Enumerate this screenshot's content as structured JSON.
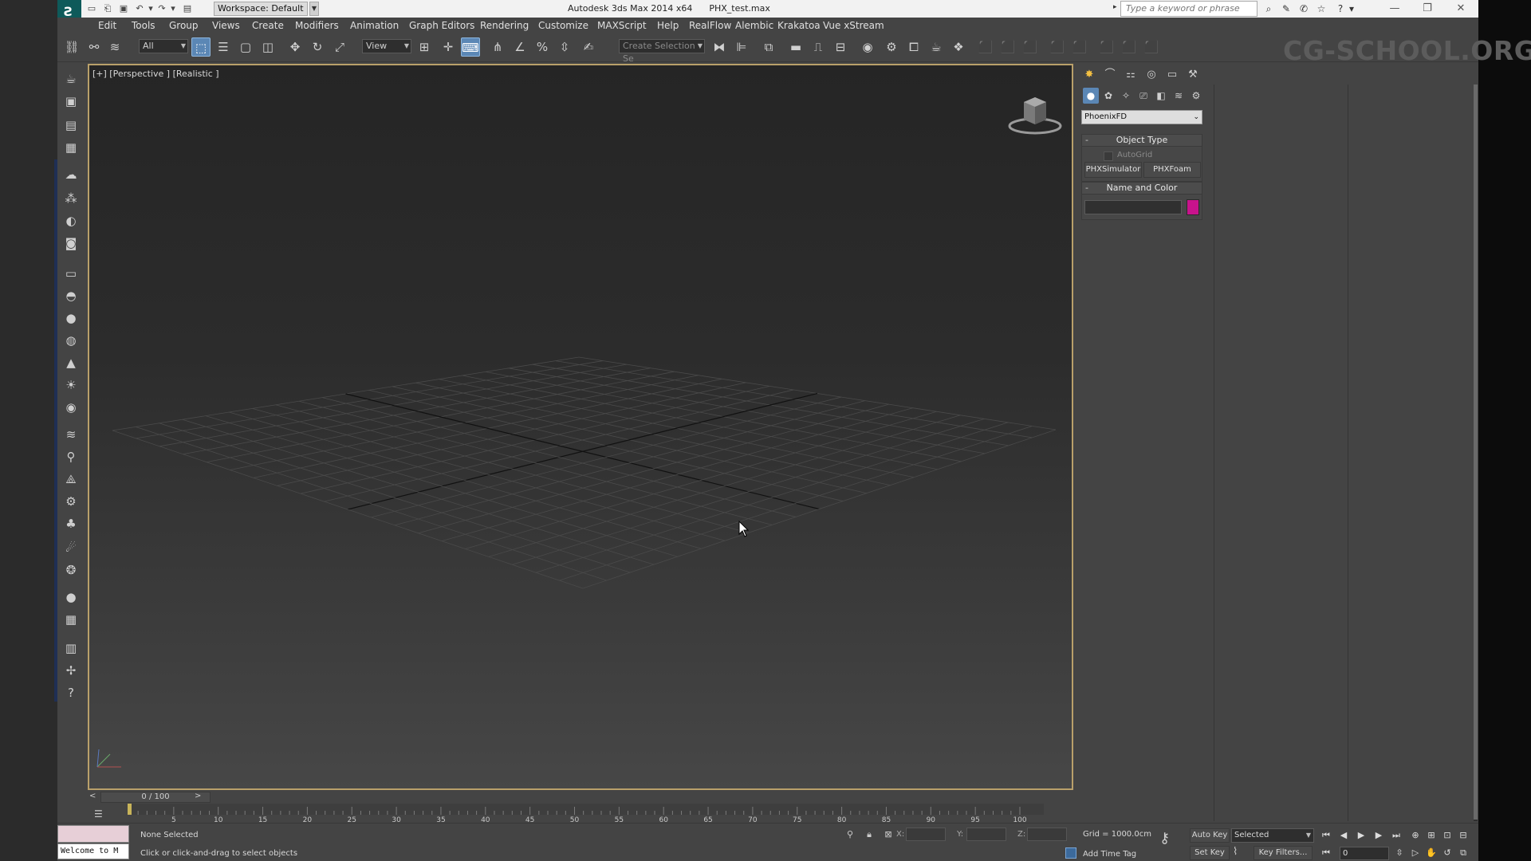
{
  "titlebar": {
    "app_logo": "3ds-max-logo",
    "workspace": "Workspace: Default",
    "app_name": "Autodesk 3ds Max 2014 x64",
    "file_name": "PHX_test.max",
    "search_placeholder": "Type a keyword or phrase"
  },
  "menu": [
    "Edit",
    "Tools",
    "Group",
    "Views",
    "Create",
    "Modifiers",
    "Animation",
    "Graph Editors",
    "Rendering",
    "Customize",
    "MAXScript",
    "Help",
    "RealFlow",
    "Alembic",
    "Krakatoa",
    "Vue xStream"
  ],
  "toolbar": {
    "selection_filter": "All",
    "reference_coord": "View",
    "named_selection_placeholder": "Create Selection Se",
    "watermark": "CG-SCHOOL.ORG"
  },
  "viewport": {
    "label": "[+] [Perspective ] [Realistic ]",
    "shading": "Realistic",
    "view": "Perspective"
  },
  "command_panel": {
    "active_tab": "create",
    "active_subtab": "geometry",
    "category": "PhoenixFD",
    "object_type": {
      "title": "Object Type",
      "autogrid_label": "AutoGrid",
      "autogrid_checked": false,
      "buttons": [
        "PHXSimulator",
        "PHXFoam"
      ]
    },
    "name_and_color": {
      "title": "Name and Color",
      "name_value": "",
      "color": "#c8138c"
    }
  },
  "time_slider": {
    "label": "0 / 100",
    "prev": "<",
    "next": ">"
  },
  "trackbar": {
    "ticks": [
      5,
      10,
      15,
      20,
      25,
      30,
      35,
      40,
      45,
      50,
      55,
      60,
      65,
      70,
      75,
      80,
      85,
      90,
      95,
      100
    ]
  },
  "status": {
    "maxscript_listener_text": "Welcome to M",
    "selection": "None Selected",
    "prompt": "Click or click-and-drag to select objects",
    "x_label": "X:",
    "y_label": "Y:",
    "z_label": "Z:",
    "grid": "Grid = 1000.0cm",
    "add_time_tag": "Add Time Tag",
    "auto_key": "Auto Key",
    "set_key": "Set Key",
    "key_mode": "Selected",
    "key_filters": "Key Filters...",
    "current_frame": "0"
  },
  "colors": {
    "viewport_border": "#b9a06a",
    "active_blue": "#5b87b5",
    "object_color": "#c8138c"
  }
}
